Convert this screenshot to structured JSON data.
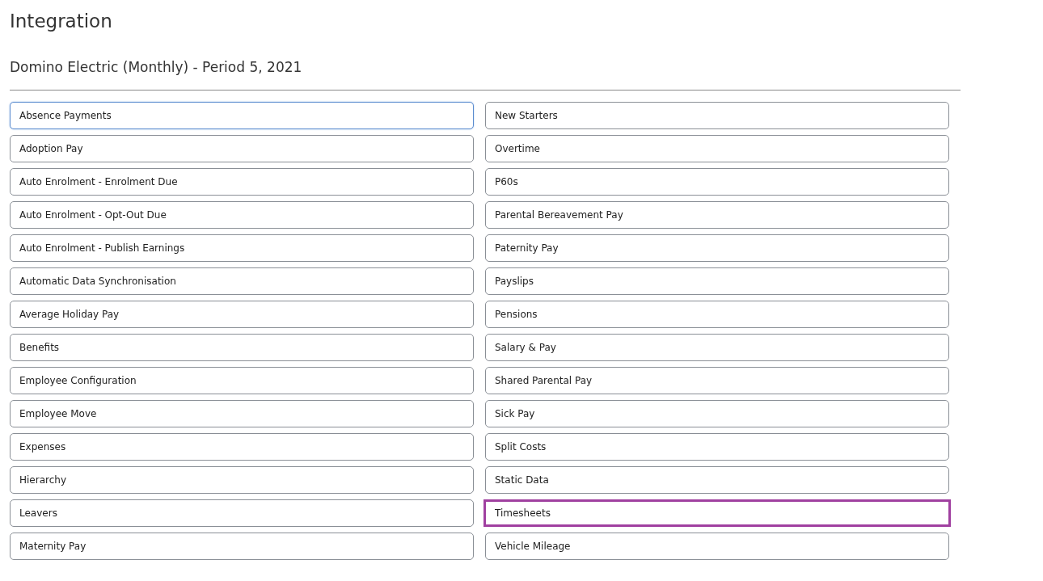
{
  "title": "Integration",
  "subtitle": "Domino Electric (Monthly) - Period 5, 2021",
  "columns": [
    {
      "buttons": [
        {
          "label": "Absence Payments",
          "focused": true,
          "highlighted": false
        },
        {
          "label": "Adoption Pay",
          "focused": false,
          "highlighted": false
        },
        {
          "label": "Auto Enrolment - Enrolment Due",
          "focused": false,
          "highlighted": false
        },
        {
          "label": "Auto Enrolment - Opt-Out Due",
          "focused": false,
          "highlighted": false
        },
        {
          "label": "Auto Enrolment - Publish Earnings",
          "focused": false,
          "highlighted": false
        },
        {
          "label": "Automatic Data Synchronisation",
          "focused": false,
          "highlighted": false
        },
        {
          "label": "Average Holiday Pay",
          "focused": false,
          "highlighted": false
        },
        {
          "label": "Benefits",
          "focused": false,
          "highlighted": false
        },
        {
          "label": "Employee Configuration",
          "focused": false,
          "highlighted": false
        },
        {
          "label": "Employee Move",
          "focused": false,
          "highlighted": false
        },
        {
          "label": "Expenses",
          "focused": false,
          "highlighted": false
        },
        {
          "label": "Hierarchy",
          "focused": false,
          "highlighted": false
        },
        {
          "label": "Leavers",
          "focused": false,
          "highlighted": false
        },
        {
          "label": "Maternity Pay",
          "focused": false,
          "highlighted": false
        }
      ]
    },
    {
      "buttons": [
        {
          "label": "New Starters",
          "focused": false,
          "highlighted": false
        },
        {
          "label": "Overtime",
          "focused": false,
          "highlighted": false
        },
        {
          "label": "P60s",
          "focused": false,
          "highlighted": false
        },
        {
          "label": "Parental Bereavement Pay",
          "focused": false,
          "highlighted": false
        },
        {
          "label": "Paternity Pay",
          "focused": false,
          "highlighted": false
        },
        {
          "label": "Payslips",
          "focused": false,
          "highlighted": false
        },
        {
          "label": "Pensions",
          "focused": false,
          "highlighted": false
        },
        {
          "label": "Salary & Pay",
          "focused": false,
          "highlighted": false
        },
        {
          "label": "Shared Parental Pay",
          "focused": false,
          "highlighted": false
        },
        {
          "label": "Sick Pay",
          "focused": false,
          "highlighted": false
        },
        {
          "label": "Split Costs",
          "focused": false,
          "highlighted": false
        },
        {
          "label": "Static Data",
          "focused": false,
          "highlighted": false
        },
        {
          "label": "Timesheets",
          "focused": false,
          "highlighted": true
        },
        {
          "label": "Vehicle Mileage",
          "focused": false,
          "highlighted": false
        }
      ]
    }
  ]
}
